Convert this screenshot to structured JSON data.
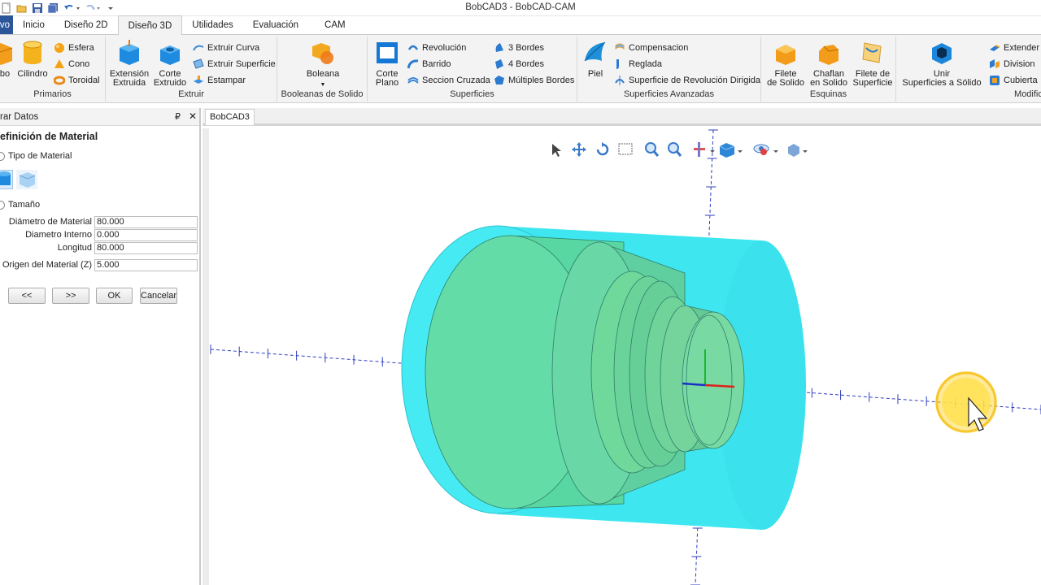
{
  "window_title": "BobCAD3 - BobCAD-CAM",
  "tabs": {
    "file": "ivo",
    "items": [
      "Inicio",
      "Diseño 2D",
      "Diseño 3D",
      "Utilidades",
      "Evaluación",
      "CAM"
    ],
    "active": "Diseño 3D"
  },
  "ribbon": {
    "primarios": {
      "label": "Primarios",
      "bo": "bo",
      "cilindro": "Cilindro",
      "esfera": "Esfera",
      "cono": "Cono",
      "toroidal": "Toroidal"
    },
    "extruir": {
      "label": "Extruir",
      "extension_1": "Extensión",
      "extension_2": "Extruida",
      "corte_1": "Corte",
      "corte_2": "Extruido",
      "extruir_curva": "Extruir Curva",
      "extruir_superficie": "Extruir Superficie",
      "estampar": "Estampar"
    },
    "booleanas": {
      "label": "Booleanas de Solido",
      "boleana": "Boleana"
    },
    "superficies": {
      "label": "Superficies",
      "corte_plano_1": "Corte",
      "corte_plano_2": "Plano",
      "revolucion": "Revolución",
      "barrido": "Barrido",
      "seccion_cruzada": "Seccion Cruzada",
      "tres_bordes": "3 Bordes",
      "cuatro_bordes": "4 Bordes",
      "multiples_bordes": "Múltiples Bordes"
    },
    "superficies_avanzadas": {
      "label": "Superficies Avanzadas",
      "piel": "Piel",
      "compensacion": "Compensacion",
      "reglada": "Reglada",
      "superficie_revolucion": "Superficie de Revolución Dirigida"
    },
    "esquinas": {
      "label": "Esquinas",
      "filete_solido_1": "Filete",
      "filete_solido_2": "de Solido",
      "chaflan_1": "Chaflan",
      "chaflan_2": "en Solido",
      "filete_superficie_1": "Filete de",
      "filete_superficie_2": "Superficie"
    },
    "modifica": {
      "label": "Modifica",
      "unir_1": "Unir",
      "unir_2": "Superficies a Sólido",
      "extender": "Extender",
      "division": "Division",
      "cubierta": "Cubierta"
    }
  },
  "panel": {
    "title": "rar Datos",
    "pin": "₽",
    "close": "✕",
    "section": "efinición de Material",
    "tipo_material": "Tipo de Material",
    "tamano": "Tamaño",
    "fields": [
      {
        "label": "Diámetro de Material",
        "value": "80.000"
      },
      {
        "label": "Diametro Interno",
        "value": "0.000"
      },
      {
        "label": "Longitud",
        "value": "80.000"
      },
      {
        "label": "Origen del Material (Z)",
        "value": "5.000"
      }
    ],
    "buttons": {
      "prev": "<<",
      "next": ">>",
      "ok": "OK",
      "cancel": "Cancelar"
    }
  },
  "document_tab": "BobCAD3",
  "colors": {
    "ribbon_bg": "#f3f3f3",
    "file_tab": "#2b579a",
    "stock": "#3ee6f0",
    "part": "#6fd99b",
    "axis": "#2f3fbf"
  }
}
